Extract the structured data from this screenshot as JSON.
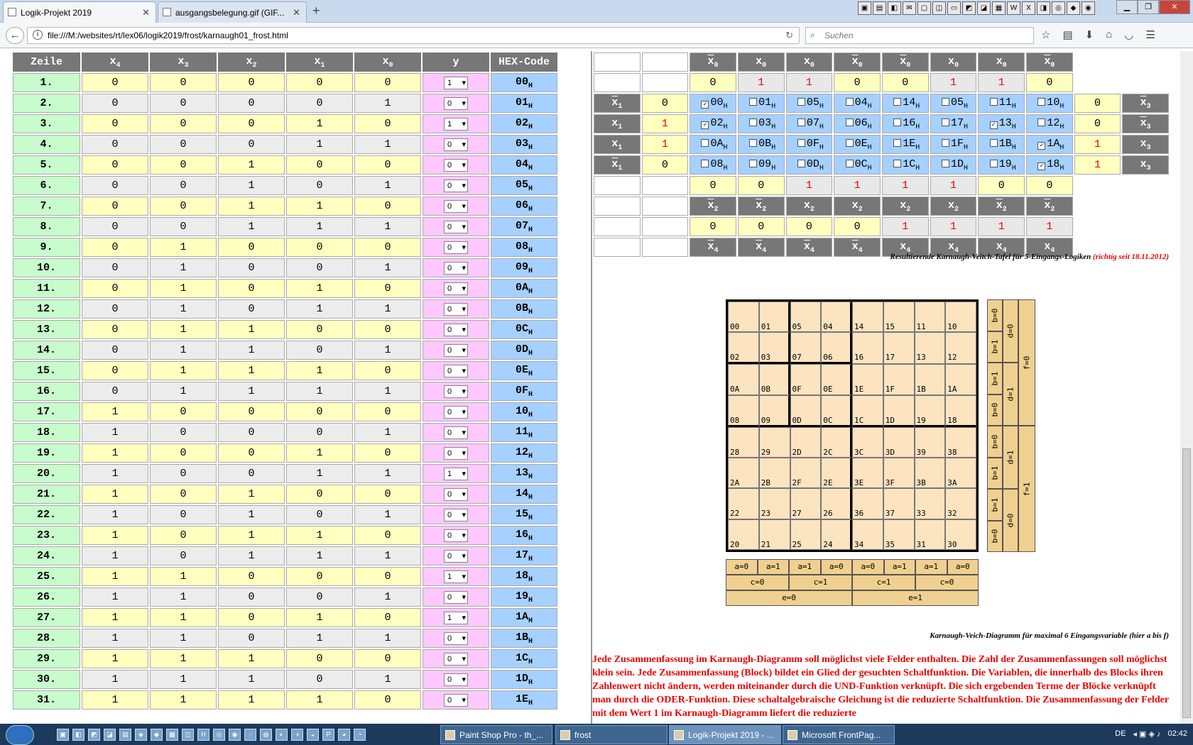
{
  "browser": {
    "tabs": [
      {
        "label": "Logik-Projekt 2019"
      },
      {
        "label": "ausgangsbelegung.gif (GIF..."
      }
    ],
    "url": "file:///M:/websites/rt/lex06/logik2019/frost/karnaugh01_frost.html",
    "search_placeholder": "Suchen"
  },
  "truth_table": {
    "headers": [
      "Zeile",
      "x4",
      "x3",
      "x2",
      "x1",
      "x0",
      "y",
      "HEX-Code"
    ],
    "hex_suffix": "H",
    "rows": [
      {
        "n": "1.",
        "b": [
          "0",
          "0",
          "0",
          "0",
          "0"
        ],
        "y": "1",
        "hex": "00"
      },
      {
        "n": "2.",
        "b": [
          "0",
          "0",
          "0",
          "0",
          "1"
        ],
        "y": "0",
        "hex": "01"
      },
      {
        "n": "3.",
        "b": [
          "0",
          "0",
          "0",
          "1",
          "0"
        ],
        "y": "1",
        "hex": "02"
      },
      {
        "n": "4.",
        "b": [
          "0",
          "0",
          "0",
          "1",
          "1"
        ],
        "y": "0",
        "hex": "03"
      },
      {
        "n": "5.",
        "b": [
          "0",
          "0",
          "1",
          "0",
          "0"
        ],
        "y": "0",
        "hex": "04"
      },
      {
        "n": "6.",
        "b": [
          "0",
          "0",
          "1",
          "0",
          "1"
        ],
        "y": "0",
        "hex": "05"
      },
      {
        "n": "7.",
        "b": [
          "0",
          "0",
          "1",
          "1",
          "0"
        ],
        "y": "0",
        "hex": "06"
      },
      {
        "n": "8.",
        "b": [
          "0",
          "0",
          "1",
          "1",
          "1"
        ],
        "y": "0",
        "hex": "07"
      },
      {
        "n": "9.",
        "b": [
          "0",
          "1",
          "0",
          "0",
          "0"
        ],
        "y": "0",
        "hex": "08"
      },
      {
        "n": "10.",
        "b": [
          "0",
          "1",
          "0",
          "0",
          "1"
        ],
        "y": "0",
        "hex": "09"
      },
      {
        "n": "11.",
        "b": [
          "0",
          "1",
          "0",
          "1",
          "0"
        ],
        "y": "0",
        "hex": "0A"
      },
      {
        "n": "12.",
        "b": [
          "0",
          "1",
          "0",
          "1",
          "1"
        ],
        "y": "0",
        "hex": "0B"
      },
      {
        "n": "13.",
        "b": [
          "0",
          "1",
          "1",
          "0",
          "0"
        ],
        "y": "0",
        "hex": "0C"
      },
      {
        "n": "14.",
        "b": [
          "0",
          "1",
          "1",
          "0",
          "1"
        ],
        "y": "0",
        "hex": "0D"
      },
      {
        "n": "15.",
        "b": [
          "0",
          "1",
          "1",
          "1",
          "0"
        ],
        "y": "0",
        "hex": "0E"
      },
      {
        "n": "16.",
        "b": [
          "0",
          "1",
          "1",
          "1",
          "1"
        ],
        "y": "0",
        "hex": "0F"
      },
      {
        "n": "17.",
        "b": [
          "1",
          "0",
          "0",
          "0",
          "0"
        ],
        "y": "0",
        "hex": "10"
      },
      {
        "n": "18.",
        "b": [
          "1",
          "0",
          "0",
          "0",
          "1"
        ],
        "y": "0",
        "hex": "11"
      },
      {
        "n": "19.",
        "b": [
          "1",
          "0",
          "0",
          "1",
          "0"
        ],
        "y": "0",
        "hex": "12"
      },
      {
        "n": "20.",
        "b": [
          "1",
          "0",
          "0",
          "1",
          "1"
        ],
        "y": "1",
        "hex": "13"
      },
      {
        "n": "21.",
        "b": [
          "1",
          "0",
          "1",
          "0",
          "0"
        ],
        "y": "0",
        "hex": "14"
      },
      {
        "n": "22.",
        "b": [
          "1",
          "0",
          "1",
          "0",
          "1"
        ],
        "y": "0",
        "hex": "15"
      },
      {
        "n": "23.",
        "b": [
          "1",
          "0",
          "1",
          "1",
          "0"
        ],
        "y": "0",
        "hex": "16"
      },
      {
        "n": "24.",
        "b": [
          "1",
          "0",
          "1",
          "1",
          "1"
        ],
        "y": "0",
        "hex": "17"
      },
      {
        "n": "25.",
        "b": [
          "1",
          "1",
          "0",
          "0",
          "0"
        ],
        "y": "1",
        "hex": "18"
      },
      {
        "n": "26.",
        "b": [
          "1",
          "1",
          "0",
          "0",
          "1"
        ],
        "y": "0",
        "hex": "19"
      },
      {
        "n": "27.",
        "b": [
          "1",
          "1",
          "0",
          "1",
          "0"
        ],
        "y": "1",
        "hex": "1A"
      },
      {
        "n": "28.",
        "b": [
          "1",
          "1",
          "0",
          "1",
          "1"
        ],
        "y": "0",
        "hex": "1B"
      },
      {
        "n": "29.",
        "b": [
          "1",
          "1",
          "1",
          "0",
          "0"
        ],
        "y": "0",
        "hex": "1C"
      },
      {
        "n": "30.",
        "b": [
          "1",
          "1",
          "1",
          "0",
          "1"
        ],
        "y": "0",
        "hex": "1D"
      },
      {
        "n": "31.",
        "b": [
          "1",
          "1",
          "1",
          "1",
          "0"
        ],
        "y": "0",
        "hex": "1E"
      }
    ]
  },
  "kv_table": {
    "top_header": [
      {
        "t": "x0",
        "ov": true
      },
      {
        "t": "x0",
        "ov": false
      },
      {
        "t": "x0",
        "ov": false
      },
      {
        "t": "x0",
        "ov": true
      },
      {
        "t": "x0",
        "ov": true
      },
      {
        "t": "x0",
        "ov": false
      },
      {
        "t": "x0",
        "ov": false
      },
      {
        "t": "x0",
        "ov": true
      }
    ],
    "top_values": [
      "0",
      "1",
      "1",
      "0",
      "0",
      "1",
      "1",
      "0"
    ],
    "rows": [
      {
        "left_label": "x1",
        "left_ov": true,
        "left_val": "0",
        "cells": [
          {
            "c": "00",
            "on": true
          },
          {
            "c": "01",
            "on": false
          },
          {
            "c": "05",
            "on": false
          },
          {
            "c": "04",
            "on": false
          },
          {
            "c": "14",
            "on": false
          },
          {
            "c": "05",
            "on": false
          },
          {
            "c": "11",
            "on": false
          },
          {
            "c": "10",
            "on": false
          }
        ],
        "right_val": "0",
        "right_label": "x3",
        "right_ov": true
      },
      {
        "left_label": "x1",
        "left_ov": false,
        "left_val": "1",
        "cells": [
          {
            "c": "02",
            "on": true
          },
          {
            "c": "03",
            "on": false
          },
          {
            "c": "07",
            "on": false
          },
          {
            "c": "06",
            "on": false
          },
          {
            "c": "16",
            "on": false
          },
          {
            "c": "17",
            "on": false
          },
          {
            "c": "13",
            "on": true
          },
          {
            "c": "12",
            "on": false
          }
        ],
        "right_val": "0",
        "right_label": "x3",
        "right_ov": true
      },
      {
        "left_label": "x1",
        "left_ov": false,
        "left_val": "1",
        "cells": [
          {
            "c": "0A",
            "on": false
          },
          {
            "c": "0B",
            "on": false
          },
          {
            "c": "0F",
            "on": false
          },
          {
            "c": "0E",
            "on": false
          },
          {
            "c": "1E",
            "on": false
          },
          {
            "c": "1F",
            "on": false
          },
          {
            "c": "1B",
            "on": false
          },
          {
            "c": "1A",
            "on": true
          }
        ],
        "right_val": "1",
        "right_label": "x3",
        "right_ov": false
      },
      {
        "left_label": "x1",
        "left_ov": true,
        "left_val": "0",
        "cells": [
          {
            "c": "08",
            "on": false
          },
          {
            "c": "09",
            "on": false
          },
          {
            "c": "0D",
            "on": false
          },
          {
            "c": "0C",
            "on": false
          },
          {
            "c": "1C",
            "on": false
          },
          {
            "c": "1D",
            "on": false
          },
          {
            "c": "19",
            "on": false
          },
          {
            "c": "18",
            "on": true
          }
        ],
        "right_val": "1",
        "right_label": "x3",
        "right_ov": false
      }
    ],
    "x2_values": [
      "0",
      "0",
      "1",
      "1",
      "1",
      "1",
      "0",
      "0"
    ],
    "x2_header": [
      {
        "t": "x2",
        "ov": true
      },
      {
        "t": "x2",
        "ov": true
      },
      {
        "t": "x2",
        "ov": false
      },
      {
        "t": "x2",
        "ov": false
      },
      {
        "t": "x2",
        "ov": false
      },
      {
        "t": "x2",
        "ov": false
      },
      {
        "t": "x2",
        "ov": true
      },
      {
        "t": "x2",
        "ov": true
      }
    ],
    "x4_values": [
      "0",
      "0",
      "0",
      "0",
      "1",
      "1",
      "1",
      "1"
    ],
    "x4_header": [
      {
        "t": "x4",
        "ov": true
      },
      {
        "t": "x4",
        "ov": true
      },
      {
        "t": "x4",
        "ov": true
      },
      {
        "t": "x4",
        "ov": true
      },
      {
        "t": "x4",
        "ov": false
      },
      {
        "t": "x4",
        "ov": false
      },
      {
        "t": "x4",
        "ov": false
      },
      {
        "t": "x4",
        "ov": false
      }
    ]
  },
  "caption1": {
    "text": "Resultierende Karnaugh-Veitch-Tafel für 5-Eingangs-Logiken",
    "red": "(richtig seit 18.11.2012)"
  },
  "kdiagram": {
    "cells": [
      "00",
      "01",
      "05",
      "04",
      "14",
      "15",
      "11",
      "10",
      "02",
      "03",
      "07",
      "06",
      "16",
      "17",
      "13",
      "12",
      "0A",
      "0B",
      "0F",
      "0E",
      "1E",
      "1F",
      "1B",
      "1A",
      "08",
      "09",
      "0D",
      "0C",
      "1C",
      "1D",
      "19",
      "18",
      "28",
      "29",
      "2D",
      "2C",
      "3C",
      "3D",
      "39",
      "38",
      "2A",
      "2B",
      "2F",
      "2E",
      "3E",
      "3F",
      "3B",
      "3A",
      "22",
      "23",
      "27",
      "26",
      "36",
      "37",
      "33",
      "32",
      "20",
      "21",
      "25",
      "24",
      "34",
      "35",
      "31",
      "30"
    ],
    "b_labels": [
      "b=0",
      "b=1",
      "b=1",
      "b=0",
      "b=0",
      "b=1",
      "b=1",
      "b=0"
    ],
    "d_labels": [
      "d=0",
      "d=1",
      "d=1",
      "d=0"
    ],
    "f_labels": [
      "f=0",
      "f=1"
    ],
    "a_labels": [
      "a=0",
      "a=1",
      "a=1",
      "a=0",
      "a=0",
      "a=1",
      "a=1",
      "a=0"
    ],
    "c_labels": [
      "c=0",
      "c=1",
      "c=1",
      "c=0"
    ],
    "e_labels": [
      "e=0",
      "e=1"
    ]
  },
  "caption2": "Karnaugh-Veich-Diagramm für maximal 6 Eingangsvariable (hier a bis f)",
  "paragraph": "Jede Zusammenfassung im Karnaugh-Diagramm soll möglichst viele Felder enthalten. Die Zahl der Zusammenfassungen soll möglichst klein sein. Jede Zusammenfassung (Block) bildet ein Glied der gesuchten Schaltfunktion. Die Variablen, die innerhalb des Blocks ihren Zahlenwert nicht ändern, werden miteinander durch die UND-Funktion verknüpft. Die sich ergebenden Terme der Blöcke verknüpft man durch die ODER-Funktion. Diese schaltalgebraische Gleichung ist die reduzierte Schaltfunktion. Die Zusammenfassung der Felder mit dem Wert 1 im Karnaugh-Diagramm liefert die reduzierte",
  "taskbar": {
    "buttons": [
      "Paint Shop Pro - th_...",
      "frost",
      "Logik-Projekt 2019 - ...",
      "Microsoft FrontPag..."
    ],
    "lang": "DE",
    "time": "02:42"
  }
}
